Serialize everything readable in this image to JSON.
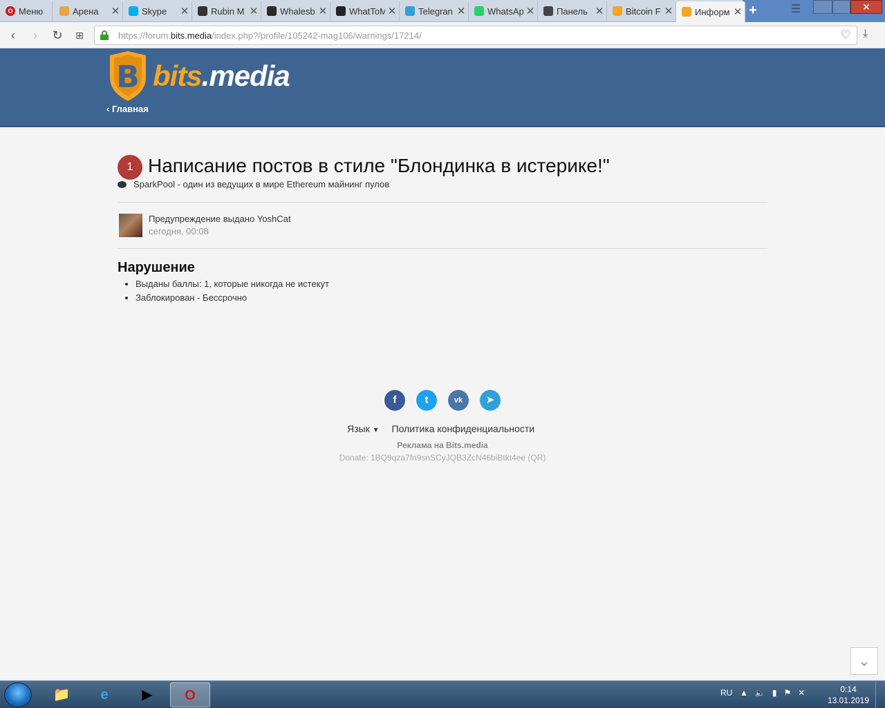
{
  "browser": {
    "menu_label": "Меню",
    "tabs": [
      {
        "label": "Арена",
        "color": "#e8a44b"
      },
      {
        "label": "Skype",
        "color": "#00aff0"
      },
      {
        "label": "Rubin M",
        "color": "#333333"
      },
      {
        "label": "Whalesb",
        "color": "#2a2a2a"
      },
      {
        "label": "WhatToM",
        "color": "#222222"
      },
      {
        "label": "Telegran",
        "color": "#2fa0d8"
      },
      {
        "label": "WhatsAp",
        "color": "#25d366"
      },
      {
        "label": "Панель",
        "color": "#444444"
      },
      {
        "label": "Bitcoin F",
        "color": "#f6a623"
      },
      {
        "label": "Информ",
        "color": "#f6a623"
      }
    ],
    "close_glyph": "✕",
    "new_tab_glyph": "+",
    "url_prefix": "https://forum.",
    "url_domain": "bits.media",
    "url_path": "/index.php?/profile/105242-mag106/warnings/17214/"
  },
  "site": {
    "logo_main": "bits",
    "logo_suffix": ".media",
    "home_link": "‹ Главная"
  },
  "warning": {
    "points": "1",
    "title": "Написание постов в стиле \"Блондинка в истерике!\"",
    "related_topic": "SparkPool - один из ведущих в мире Ethereum майнинг пулов",
    "issued_by": "Предупреждение выдано YoshCat",
    "issued_date": "сегодня, 00:08",
    "section_title": "Нарушение",
    "items": [
      "Выданы баллы: 1, которые никогда не истекут",
      "Заблокирован - Бессрочно"
    ]
  },
  "footer": {
    "social": [
      {
        "name": "facebook",
        "glyph": "f"
      },
      {
        "name": "twitter",
        "glyph": "t"
      },
      {
        "name": "vk",
        "glyph": "vk"
      },
      {
        "name": "telegram",
        "glyph": "➤"
      }
    ],
    "language": "Язык",
    "privacy": "Политика конфиденциальности",
    "ads": "Реклама на Bits.media",
    "donate": "Donate: 1BQ9qza7fn9snSCyJQB3ZcN46biBtkt4ee (QR)"
  },
  "taskbar": {
    "lang": "RU",
    "time": "0:14",
    "date": "13.01.2019"
  }
}
